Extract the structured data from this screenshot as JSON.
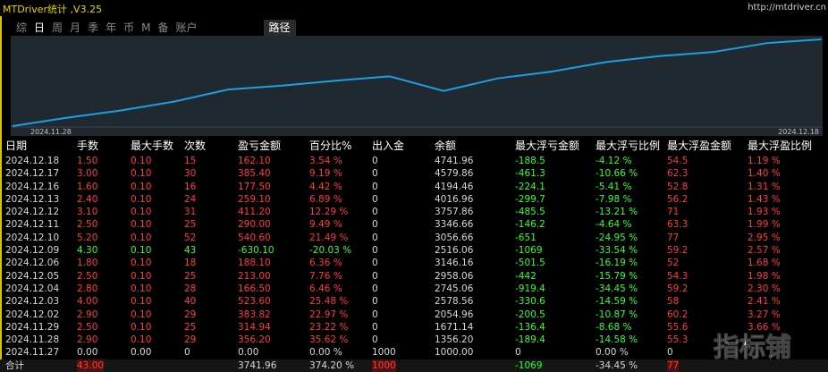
{
  "app": {
    "title": "MTDriver统计 ,V3.25",
    "url": "http://mtdriver.cn",
    "watermark": "指标铺"
  },
  "tabs": [
    {
      "label": "综",
      "active": false
    },
    {
      "label": "日",
      "active": true
    },
    {
      "label": "周",
      "active": false
    },
    {
      "label": "月",
      "active": false
    },
    {
      "label": "季",
      "active": false
    },
    {
      "label": "年",
      "active": false
    },
    {
      "label": "币",
      "active": false
    },
    {
      "label": "M",
      "active": false
    },
    {
      "label": "备",
      "active": false
    },
    {
      "label": "账户",
      "active": false
    },
    {
      "label": "路径",
      "active": false
    }
  ],
  "chart_data": {
    "type": "line",
    "x": [
      "2024.11.27",
      "2024.11.28",
      "2024.11.29",
      "2024.12.02",
      "2024.12.03",
      "2024.12.04",
      "2024.12.05",
      "2024.12.06",
      "2024.12.09",
      "2024.12.10",
      "2024.12.11",
      "2024.12.12",
      "2024.12.13",
      "2024.12.16",
      "2024.12.17",
      "2024.12.18"
    ],
    "series": [
      {
        "values": [
          1000.0,
          1356.2,
          1671.14,
          2054.96,
          2578.56,
          2745.06,
          2958.06,
          3146.16,
          2516.06,
          3056.66,
          3346.66,
          3757.86,
          4016.96,
          4194.46,
          4579.86,
          4741.96
        ],
        "color": "#1aa0e6"
      }
    ],
    "x_tick_labels": [
      "2024.11.28",
      "2024.12.18"
    ],
    "grid": false
  },
  "columns": [
    "日期",
    "手数",
    "最大手数",
    "次数",
    "盈亏金额",
    "百分比%",
    "出入金",
    "余额",
    "最大浮亏金额",
    "最大浮亏比例",
    "最大浮盈金额",
    "最大浮盈比例"
  ],
  "rows": [
    {
      "date": "2024.12.18",
      "lots": "1.50",
      "maxlots": "0.10",
      "count": "15",
      "pnl": "162.10",
      "pct": "3.54 %",
      "io": "0",
      "balance": "4741.96",
      "mfl": "-188.5",
      "mflp": "-4.12 %",
      "mfp": "54.5",
      "mfpp": "1.19 %",
      "color": "red"
    },
    {
      "date": "2024.12.17",
      "lots": "3.00",
      "maxlots": "0.10",
      "count": "30",
      "pnl": "385.40",
      "pct": "9.19 %",
      "io": "0",
      "balance": "4579.86",
      "mfl": "-461.3",
      "mflp": "-10.66 %",
      "mfp": "62.3",
      "mfpp": "1.40 %",
      "color": "red"
    },
    {
      "date": "2024.12.16",
      "lots": "1.60",
      "maxlots": "0.10",
      "count": "16",
      "pnl": "177.50",
      "pct": "4.42 %",
      "io": "0",
      "balance": "4194.46",
      "mfl": "-224.1",
      "mflp": "-5.41 %",
      "mfp": "52.8",
      "mfpp": "1.31 %",
      "color": "red"
    },
    {
      "date": "2024.12.13",
      "lots": "2.40",
      "maxlots": "0.10",
      "count": "24",
      "pnl": "259.10",
      "pct": "6.89 %",
      "io": "0",
      "balance": "4016.96",
      "mfl": "-299.7",
      "mflp": "-7.98 %",
      "mfp": "56.2",
      "mfpp": "1.43 %",
      "color": "red"
    },
    {
      "date": "2024.12.12",
      "lots": "3.10",
      "maxlots": "0.10",
      "count": "31",
      "pnl": "411.20",
      "pct": "12.29 %",
      "io": "0",
      "balance": "3757.86",
      "mfl": "-485.5",
      "mflp": "-13.21 %",
      "mfp": "71",
      "mfpp": "1.93 %",
      "color": "red"
    },
    {
      "date": "2024.12.11",
      "lots": "2.50",
      "maxlots": "0.10",
      "count": "25",
      "pnl": "290.00",
      "pct": "9.49 %",
      "io": "0",
      "balance": "3346.66",
      "mfl": "-146.2",
      "mflp": "-4.64 %",
      "mfp": "63.3",
      "mfpp": "1.99 %",
      "color": "red"
    },
    {
      "date": "2024.12.10",
      "lots": "5.20",
      "maxlots": "0.10",
      "count": "52",
      "pnl": "540.60",
      "pct": "21.49 %",
      "io": "0",
      "balance": "3056.66",
      "mfl": "-651",
      "mflp": "-24.95 %",
      "mfp": "77",
      "mfpp": "2.95 %",
      "color": "red"
    },
    {
      "date": "2024.12.09",
      "lots": "4.30",
      "maxlots": "0.10",
      "count": "43",
      "pnl": "-630.10",
      "pct": "-20.03 %",
      "io": "0",
      "balance": "2516.06",
      "mfl": "-1069",
      "mflp": "-33.54 %",
      "mfp": "59.2",
      "mfpp": "2.57 %",
      "color": "green"
    },
    {
      "date": "2024.12.06",
      "lots": "1.80",
      "maxlots": "0.10",
      "count": "18",
      "pnl": "188.10",
      "pct": "6.36 %",
      "io": "0",
      "balance": "3146.16",
      "mfl": "-501.5",
      "mflp": "-16.19 %",
      "mfp": "52",
      "mfpp": "1.68 %",
      "color": "red"
    },
    {
      "date": "2024.12.05",
      "lots": "2.50",
      "maxlots": "0.10",
      "count": "25",
      "pnl": "213.00",
      "pct": "7.76 %",
      "io": "0",
      "balance": "2958.06",
      "mfl": "-442",
      "mflp": "-15.79 %",
      "mfp": "54.3",
      "mfpp": "1.98 %",
      "color": "red"
    },
    {
      "date": "2024.12.04",
      "lots": "2.80",
      "maxlots": "0.10",
      "count": "28",
      "pnl": "166.50",
      "pct": "6.46 %",
      "io": "0",
      "balance": "2745.06",
      "mfl": "-919.4",
      "mflp": "-34.45 %",
      "mfp": "59.2",
      "mfpp": "2.30 %",
      "color": "red"
    },
    {
      "date": "2024.12.03",
      "lots": "4.00",
      "maxlots": "0.10",
      "count": "40",
      "pnl": "523.60",
      "pct": "25.48 %",
      "io": "0",
      "balance": "2578.56",
      "mfl": "-330.6",
      "mflp": "-14.59 %",
      "mfp": "58",
      "mfpp": "2.41 %",
      "color": "red"
    },
    {
      "date": "2024.12.02",
      "lots": "2.90",
      "maxlots": "0.10",
      "count": "29",
      "pnl": "383.82",
      "pct": "22.97 %",
      "io": "0",
      "balance": "2054.96",
      "mfl": "-200.5",
      "mflp": "-10.87 %",
      "mfp": "60.2",
      "mfpp": "3.27 %",
      "color": "red"
    },
    {
      "date": "2024.11.29",
      "lots": "2.50",
      "maxlots": "0.10",
      "count": "25",
      "pnl": "314.94",
      "pct": "23.22 %",
      "io": "0",
      "balance": "1671.14",
      "mfl": "-136.4",
      "mflp": "-8.68 %",
      "mfp": "55.6",
      "mfpp": "3.66 %",
      "color": "red"
    },
    {
      "date": "2024.11.28",
      "lots": "2.90",
      "maxlots": "0.10",
      "count": "29",
      "pnl": "356.20",
      "pct": "35.62 %",
      "io": "0",
      "balance": "1356.20",
      "mfl": "-189.4",
      "mflp": "-14.58 %",
      "mfp": "55.3",
      "mfpp": "",
      "color": "red"
    },
    {
      "date": "2024.11.27",
      "lots": "0.00",
      "maxlots": "0.00",
      "count": "0",
      "pnl": "0.00",
      "pct": "0.00 %",
      "io": "1000",
      "balance": "1000.00",
      "mfl": "0",
      "mflp": "0.00 %",
      "mfp": "0",
      "mfpp": "",
      "color": "white"
    }
  ],
  "total": {
    "label": "合计",
    "lots": "43.00",
    "pnl": "3741.96",
    "pct": "374.20 %",
    "io": "1000",
    "mfl": "-1069",
    "mflp": "-34.45 %",
    "mfp": "77"
  },
  "colors": {
    "up": "#ff3a3a",
    "down": "#33ff33",
    "neutral": "#d8d8d8",
    "title": "#e8d400",
    "line": "#1aa0e6",
    "chart_bg": "#202830"
  }
}
